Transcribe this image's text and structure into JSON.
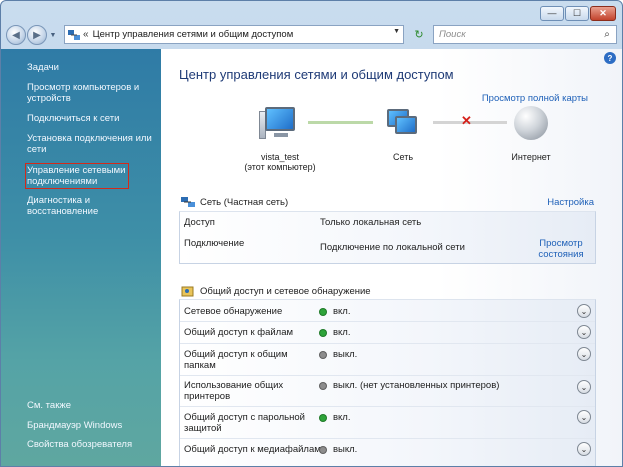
{
  "window": {
    "caption_min": "—",
    "caption_max": "☐",
    "caption_close": "✕"
  },
  "nav": {
    "back_glyph": "◀",
    "forward_glyph": "▶",
    "history_glyph": "▼",
    "address_prefix": "«",
    "address": "Центр управления сетями и общим доступом",
    "address_dropdown": "▼",
    "refresh_glyph": "↻",
    "search_placeholder": "Поиск",
    "search_glyph": "⌕"
  },
  "sidebar": {
    "items": [
      {
        "label": "Задачи"
      },
      {
        "label": "Просмотр компьютеров и устройств"
      },
      {
        "label": "Подключиться к сети"
      },
      {
        "label": "Установка подключения или сети"
      },
      {
        "label": "Управление сетевыми подключениями"
      },
      {
        "label": "Диагностика и восстановление"
      }
    ],
    "see_also": [
      {
        "label": "См. также"
      },
      {
        "label": "Брандмауэр Windows"
      },
      {
        "label": "Свойства обозревателя"
      }
    ]
  },
  "main": {
    "help_glyph": "?",
    "title": "Центр управления сетями и общим доступом",
    "full_map_link": "Просмотр полной карты",
    "map": {
      "computer_name": "vista_test",
      "computer_sub": "(этот компьютер)",
      "network_label": "Сеть",
      "internet_label": "Интернет",
      "broken_mark": "✕"
    },
    "network": {
      "title": "Сеть (Частная сеть)",
      "settings_link": "Настройка",
      "rows": [
        {
          "label": "Доступ",
          "value": "Только локальная сеть"
        },
        {
          "label": "Подключение",
          "value": "Подключение по локальной сети",
          "link": "Просмотр состояния"
        }
      ]
    },
    "sharing": {
      "title": "Общий доступ и сетевое обнаружение",
      "rows": [
        {
          "label": "Сетевое обнаружение",
          "value": "вкл.",
          "state": "on"
        },
        {
          "label": "Общий доступ к файлам",
          "value": "вкл.",
          "state": "on"
        },
        {
          "label": "Общий доступ к общим папкам",
          "value": "выкл.",
          "state": "off"
        },
        {
          "label": "Использование общих принтеров",
          "value": "выкл. (нет установленных принтеров)",
          "state": "off"
        },
        {
          "label": "Общий доступ с парольной защитой",
          "value": "вкл.",
          "state": "on"
        },
        {
          "label": "Общий доступ к медиафайлам",
          "value": "выкл.",
          "state": "off"
        }
      ],
      "expand_glyph": "⌄"
    }
  },
  "colors": {
    "accent_link": "#1f61b8",
    "title_color": "#1e3a76",
    "status_on": "#2ea43a",
    "status_off": "#8d8d8d",
    "highlight_box": "#d42a1a"
  }
}
